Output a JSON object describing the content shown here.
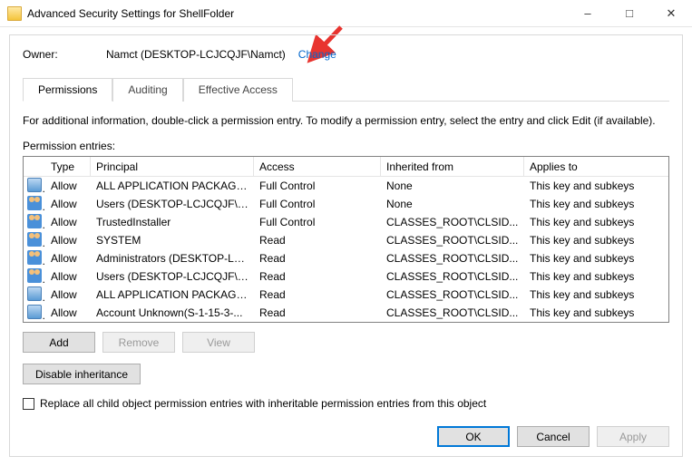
{
  "window": {
    "title": "Advanced Security Settings for ShellFolder"
  },
  "owner": {
    "label": "Owner:",
    "value": "Namct (DESKTOP-LCJCQJF\\Namct)",
    "change_link": "Change"
  },
  "tabs": {
    "permissions": "Permissions",
    "auditing": "Auditing",
    "effective": "Effective Access"
  },
  "info_line": "For additional information, double-click a permission entry. To modify a permission entry, select the entry and click Edit (if available).",
  "entries_label": "Permission entries:",
  "columns": {
    "type": "Type",
    "principal": "Principal",
    "access": "Access",
    "inherited": "Inherited from",
    "applies": "Applies to"
  },
  "entries": [
    {
      "icon": "pkg",
      "type": "Allow",
      "principal": "ALL APPLICATION PACKAGES",
      "access": "Full Control",
      "inherited": "None",
      "applies": "This key and subkeys"
    },
    {
      "icon": "users",
      "type": "Allow",
      "principal": "Users (DESKTOP-LCJCQJF\\Use...",
      "access": "Full Control",
      "inherited": "None",
      "applies": "This key and subkeys"
    },
    {
      "icon": "users",
      "type": "Allow",
      "principal": "TrustedInstaller",
      "access": "Full Control",
      "inherited": "CLASSES_ROOT\\CLSID...",
      "applies": "This key and subkeys"
    },
    {
      "icon": "users",
      "type": "Allow",
      "principal": "SYSTEM",
      "access": "Read",
      "inherited": "CLASSES_ROOT\\CLSID...",
      "applies": "This key and subkeys"
    },
    {
      "icon": "users",
      "type": "Allow",
      "principal": "Administrators (DESKTOP-LCJ...",
      "access": "Read",
      "inherited": "CLASSES_ROOT\\CLSID...",
      "applies": "This key and subkeys"
    },
    {
      "icon": "users",
      "type": "Allow",
      "principal": "Users (DESKTOP-LCJCQJF\\Use...",
      "access": "Read",
      "inherited": "CLASSES_ROOT\\CLSID...",
      "applies": "This key and subkeys"
    },
    {
      "icon": "pkg",
      "type": "Allow",
      "principal": "ALL APPLICATION PACKAGES",
      "access": "Read",
      "inherited": "CLASSES_ROOT\\CLSID...",
      "applies": "This key and subkeys"
    },
    {
      "icon": "pkg",
      "type": "Allow",
      "principal": "Account Unknown(S-1-15-3-...",
      "access": "Read",
      "inherited": "CLASSES_ROOT\\CLSID...",
      "applies": "This key and subkeys"
    }
  ],
  "buttons": {
    "add": "Add",
    "remove": "Remove",
    "view": "View",
    "disable_inheritance": "Disable inheritance",
    "ok": "OK",
    "cancel": "Cancel",
    "apply": "Apply"
  },
  "checkbox_label": "Replace all child object permission entries with inheritable permission entries from this object"
}
